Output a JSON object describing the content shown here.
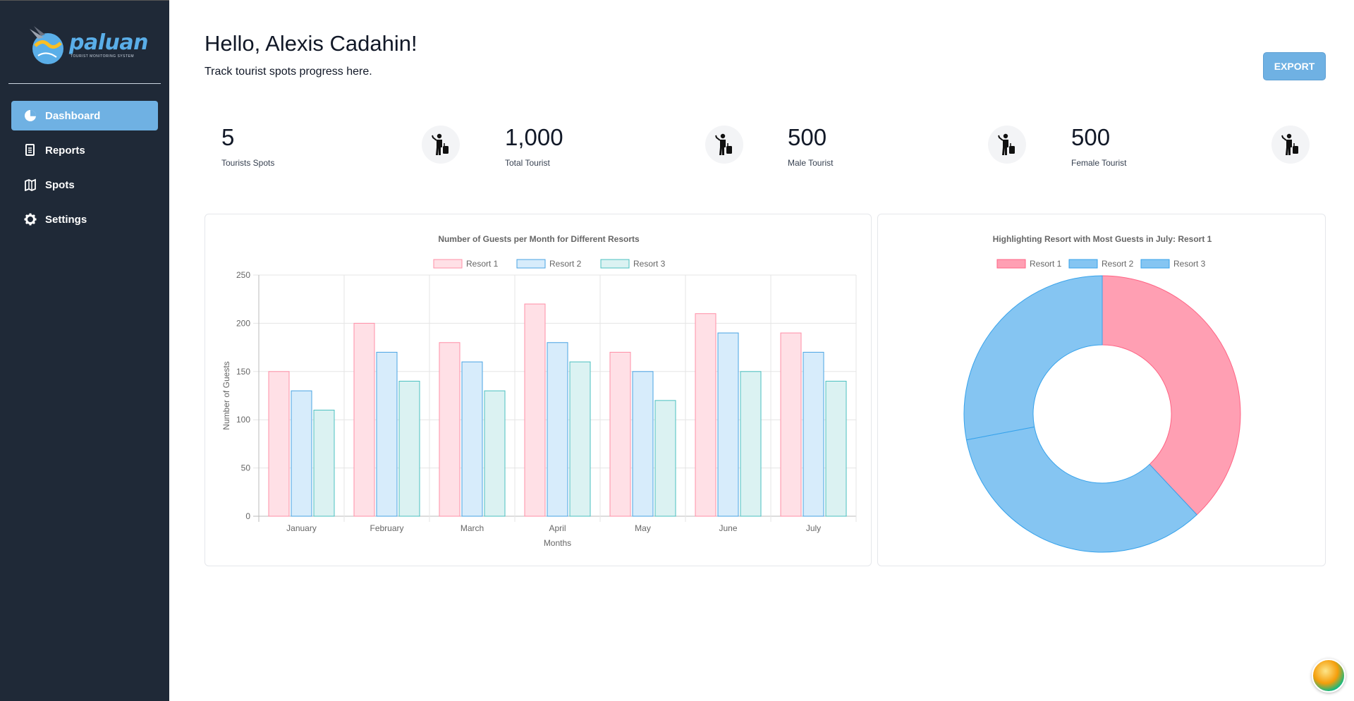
{
  "brand": {
    "name": "paluan",
    "tagline": "TOURIST MONITORING SYSTEM"
  },
  "sidebar": {
    "items": [
      {
        "label": "Dashboard",
        "icon": "pie-chart-icon",
        "active": true
      },
      {
        "label": "Reports",
        "icon": "document-icon",
        "active": false
      },
      {
        "label": "Spots",
        "icon": "map-icon",
        "active": false
      },
      {
        "label": "Settings",
        "icon": "gear-icon",
        "active": false
      }
    ]
  },
  "header": {
    "greeting": "Hello, Alexis Cadahin!",
    "subtitle": "Track tourist spots progress here.",
    "export_label": "EXPORT"
  },
  "stats": [
    {
      "value": "5",
      "label": "Tourists Spots",
      "bg": "#e1effe",
      "icon": "traveler-icon"
    },
    {
      "value": "1,000",
      "label": "Total Tourist",
      "bg": "#def7ec",
      "icon": "traveler-icon"
    },
    {
      "value": "500",
      "label": "Male Tourist",
      "bg": "#fde8e8",
      "icon": "traveler-icon"
    },
    {
      "value": "500",
      "label": "Female Tourist",
      "bg": "#fdf6b2",
      "icon": "traveler-icon"
    }
  ],
  "chart_data": [
    {
      "type": "bar",
      "title": "Number of Guests per Month for Different Resorts",
      "xlabel": "Months",
      "ylabel": "Number of Guests",
      "categories": [
        "January",
        "February",
        "March",
        "April",
        "May",
        "June",
        "July"
      ],
      "ylim": [
        0,
        250
      ],
      "yticks": [
        0,
        50,
        100,
        150,
        200,
        250
      ],
      "grid": true,
      "legend": "top",
      "series": [
        {
          "name": "Resort 1",
          "values": [
            150,
            200,
            180,
            220,
            170,
            210,
            190
          ],
          "fill": "#ffe0e6",
          "stroke": "#ff8fa7"
        },
        {
          "name": "Resort 2",
          "values": [
            130,
            170,
            160,
            180,
            150,
            190,
            170
          ],
          "fill": "#d7ecfb",
          "stroke": "#4aa3e3"
        },
        {
          "name": "Resort 3",
          "values": [
            110,
            140,
            130,
            160,
            120,
            150,
            140
          ],
          "fill": "#dbf2f2",
          "stroke": "#4bc0c0"
        }
      ]
    },
    {
      "type": "pie",
      "subtype": "doughnut",
      "title": "Highlighting Resort with Most Guests in July: Resort 1",
      "legend": "top",
      "labels": [
        "Resort 1",
        "Resort 2",
        "Resort 3"
      ],
      "values": [
        190,
        170,
        140
      ],
      "colors": [
        "#ff9fb3",
        "#85c5f2",
        "#85c5f2"
      ],
      "borders": [
        "#ff6384",
        "#36a2eb",
        "#36a2eb"
      ]
    }
  ]
}
